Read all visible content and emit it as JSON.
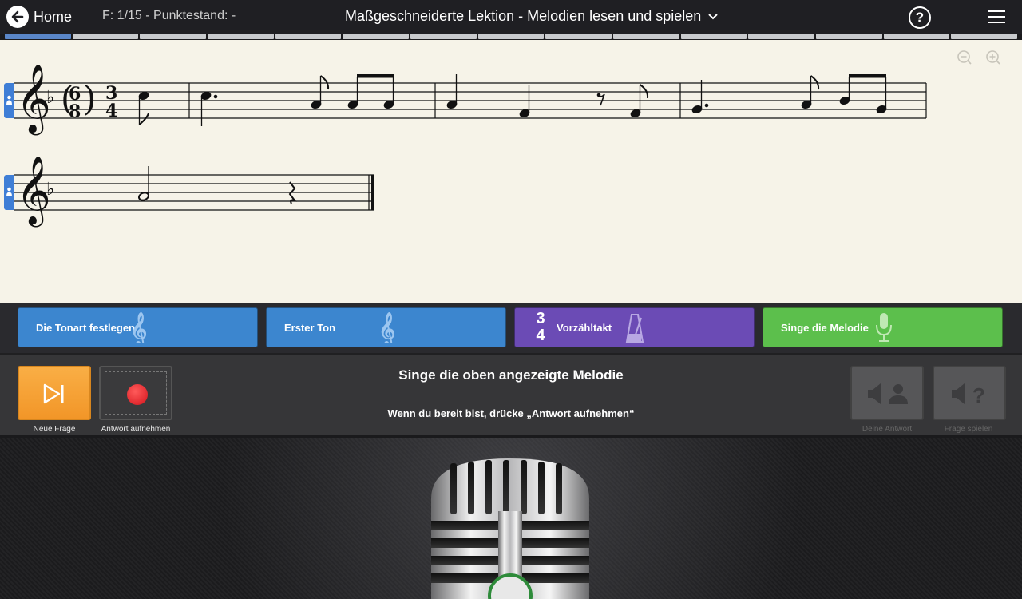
{
  "topbar": {
    "home_label": "Home",
    "question_info": "F: 1/15 - Punktestand: -",
    "lesson_title": "Maßgeschneiderte Lektion - Melodien lesen und spielen",
    "help_label": "?"
  },
  "progress": {
    "total": 15,
    "current": 1
  },
  "score": {
    "time_signature_alt": {
      "top": "6",
      "bottom": "8"
    },
    "time_signature": {
      "top": "3",
      "bottom": "4"
    }
  },
  "steps": [
    {
      "label": "Die Tonart festlegen",
      "color": "#3c86cf",
      "icon": "treble-clef-icon"
    },
    {
      "label": "Erster Ton",
      "color": "#3c86cf",
      "icon": "treble-clef-icon"
    },
    {
      "label": "Vorzähltakt",
      "color": "#6b4bb5",
      "icon": "metronome-icon",
      "ts_top": "3",
      "ts_bottom": "4"
    },
    {
      "label": "Singe die Melodie",
      "color": "#5cbf4c",
      "icon": "microphone-icon"
    }
  ],
  "controls": {
    "new_question_label": "Neue Frage",
    "record_label": "Antwort aufnehmen",
    "your_answer_label": "Deine Antwort",
    "play_question_label": "Frage spielen"
  },
  "instructions": {
    "title": "Singe die oben angezeigte Melodie",
    "subtitle": "Wenn du bereit bist, drücke „Antwort aufnehmen“"
  },
  "colors": {
    "accent": "#3f7ed6",
    "orange": "#f5a033",
    "record": "#e8222a"
  }
}
